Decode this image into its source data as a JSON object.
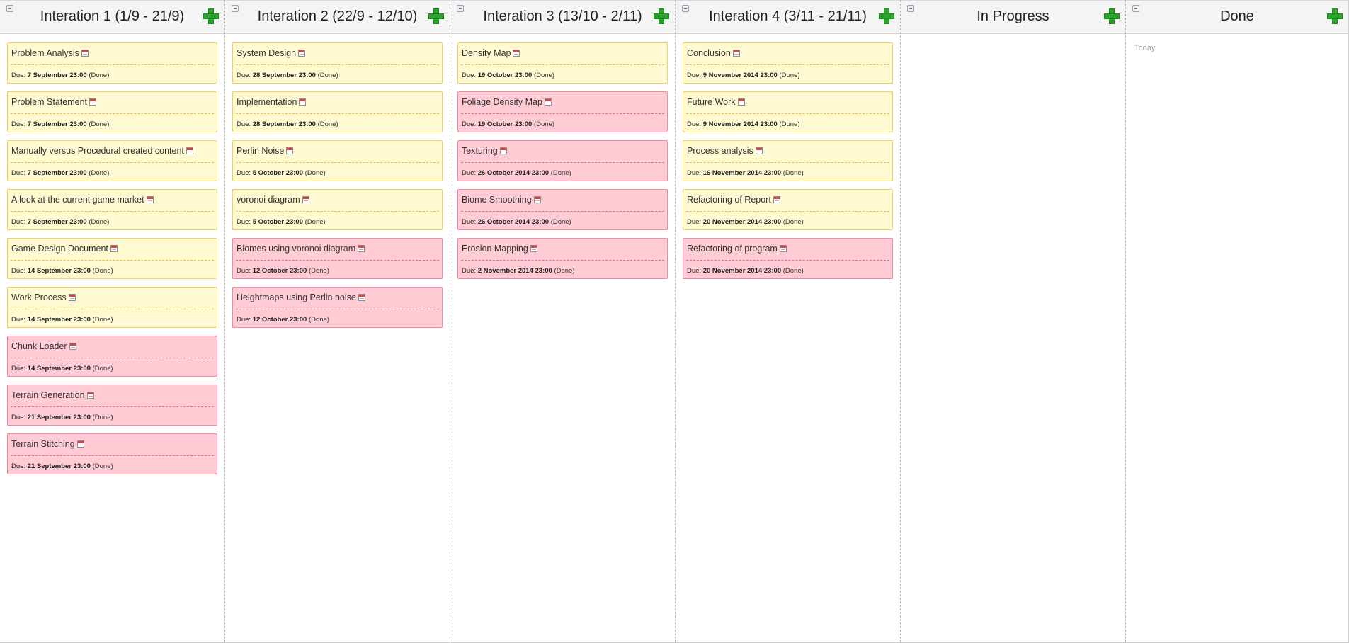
{
  "board": {
    "due_prefix": "Due:",
    "columns": [
      {
        "title": "Interation 1 (1/9 - 21/9)",
        "cards": [
          {
            "title": "Problem Analysis",
            "due": "7 September 23:00",
            "status": "(Done)",
            "color": "yellow"
          },
          {
            "title": "Problem Statement",
            "due": "7 September 23:00",
            "status": "(Done)",
            "color": "yellow"
          },
          {
            "title": "Manually versus Procedural created content",
            "due": "7 September 23:00",
            "status": "(Done)",
            "color": "yellow"
          },
          {
            "title": "A look at the current game market",
            "due": "7 September 23:00",
            "status": "(Done)",
            "color": "yellow"
          },
          {
            "title": "Game Design Document",
            "due": "14 September 23:00",
            "status": "(Done)",
            "color": "yellow"
          },
          {
            "title": "Work Process",
            "due": "14 September 23:00",
            "status": "(Done)",
            "color": "yellow"
          },
          {
            "title": "Chunk Loader",
            "due": "14 September 23:00",
            "status": "(Done)",
            "color": "pink"
          },
          {
            "title": "Terrain Generation",
            "due": "21 September 23:00",
            "status": "(Done)",
            "color": "pink"
          },
          {
            "title": "Terrain Stitching",
            "due": "21 September 23:00",
            "status": "(Done)",
            "color": "pink"
          }
        ]
      },
      {
        "title": "Interation 2 (22/9 - 12/10)",
        "cards": [
          {
            "title": "System Design",
            "due": "28 September 23:00",
            "status": "(Done)",
            "color": "yellow"
          },
          {
            "title": "Implementation",
            "due": "28 September 23:00",
            "status": "(Done)",
            "color": "yellow"
          },
          {
            "title": "Perlin Noise",
            "due": "5 October 23:00",
            "status": "(Done)",
            "color": "yellow"
          },
          {
            "title": "voronoi diagram",
            "due": "5 October 23:00",
            "status": "(Done)",
            "color": "yellow"
          },
          {
            "title": "Biomes using voronoi diagram",
            "due": "12 October 23:00",
            "status": "(Done)",
            "color": "pink"
          },
          {
            "title": "Heightmaps using Perlin noise",
            "due": "12 October 23:00",
            "status": "(Done)",
            "color": "pink"
          }
        ]
      },
      {
        "title": "Interation 3 (13/10 - 2/11)",
        "cards": [
          {
            "title": "Density Map",
            "due": "19 October 23:00",
            "status": "(Done)",
            "color": "yellow"
          },
          {
            "title": "Foliage Density Map",
            "due": "19 October 23:00",
            "status": "(Done)",
            "color": "pink"
          },
          {
            "title": "Texturing",
            "due": "26 October 2014 23:00",
            "status": "(Done)",
            "color": "pink"
          },
          {
            "title": "Biome Smoothing",
            "due": "26 October 2014 23:00",
            "status": "(Done)",
            "color": "pink"
          },
          {
            "title": "Erosion Mapping",
            "due": "2 November 2014 23:00",
            "status": "(Done)",
            "color": "pink"
          }
        ]
      },
      {
        "title": "Interation 4 (3/11 - 21/11)",
        "cards": [
          {
            "title": "Conclusion",
            "due": "9 November 2014 23:00",
            "status": "(Done)",
            "color": "yellow"
          },
          {
            "title": "Future Work",
            "due": "9 November 2014 23:00",
            "status": "(Done)",
            "color": "yellow"
          },
          {
            "title": "Process analysis",
            "due": "16 November 2014 23:00",
            "status": "(Done)",
            "color": "yellow"
          },
          {
            "title": "Refactoring of Report",
            "due": "20 November 2014 23:00",
            "status": "(Done)",
            "color": "yellow"
          },
          {
            "title": "Refactoring of program",
            "due": "20 November 2014 23:00",
            "status": "(Done)",
            "color": "pink"
          }
        ]
      },
      {
        "title": "In Progress",
        "cards": []
      },
      {
        "title": "Done",
        "cards": [],
        "note": "Today"
      }
    ]
  },
  "colors": {
    "yellow_card_bg": "#fff9d2",
    "yellow_card_border": "#f2d15a",
    "pink_card_bg": "#ffccd6",
    "pink_card_border": "#f08aa1",
    "add_icon": "#2aa52a",
    "header_bg": "#f4f4f4"
  },
  "icons": {
    "collapse": "collapse-minus-icon",
    "add": "green-plus-icon",
    "due_date": "calendar-icon"
  }
}
